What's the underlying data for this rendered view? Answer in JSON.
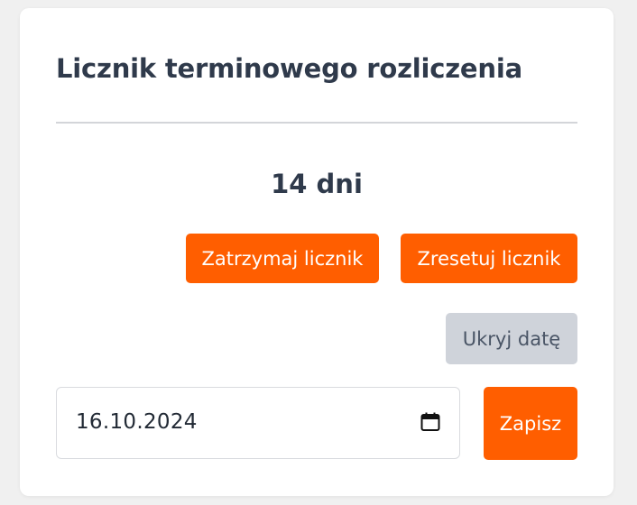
{
  "card": {
    "title": "Licznik terminowego rozliczenia",
    "counter_text": "14 dni"
  },
  "buttons": {
    "stop_label": "Zatrzymaj licznik",
    "reset_label": "Zresetuj licznik",
    "hide_date_label": "Ukryj datę",
    "save_label": "Zapisz"
  },
  "date_input": {
    "value": "16.10.2024",
    "icon": "calendar-icon"
  },
  "colors": {
    "accent": "#ff5e00",
    "secondary_button": "#cfd3da",
    "heading_text": "#2f3a4b",
    "background": "#f0f0f0",
    "card": "#ffffff"
  }
}
